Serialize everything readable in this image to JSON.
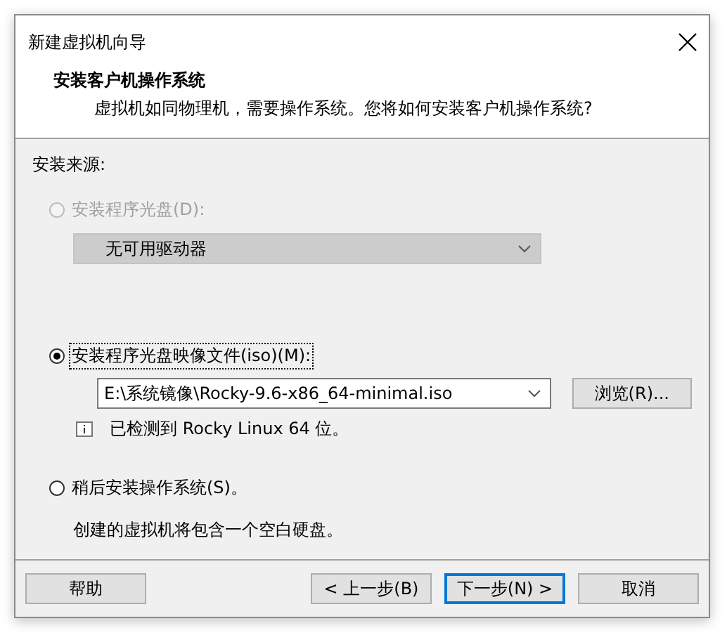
{
  "window": {
    "title": "新建虚拟机向导"
  },
  "header": {
    "title": "安装客户机操作系统",
    "subtitle": "虚拟机如同物理机，需要操作系统。您将如何安装客户机操作系统?"
  },
  "source_label": "安装来源:",
  "options": [
    {
      "kind": "disc",
      "label": "安装程序光盘(D):",
      "selected": false,
      "disabled": true,
      "drive": "无可用驱动器"
    },
    {
      "kind": "iso",
      "label": "安装程序光盘映像文件(iso)(M):",
      "selected": true,
      "disabled": false,
      "path": "E:\\系统镜像\\Rocky-9.6-x86_64-minimal.iso",
      "browse": "浏览(R)...",
      "detected": "已检测到 Rocky Linux 64 位。"
    },
    {
      "kind": "later",
      "label": "稍后安装操作系统(S)。",
      "selected": false,
      "disabled": false,
      "note": "创建的虚拟机将包含一个空白硬盘。"
    }
  ],
  "buttons": [
    {
      "label": "帮助",
      "default": false
    },
    {
      "label": "< 上一步(B)",
      "default": false
    },
    {
      "label": "下一步(N) >",
      "default": true
    },
    {
      "label": "取消",
      "default": false
    }
  ]
}
